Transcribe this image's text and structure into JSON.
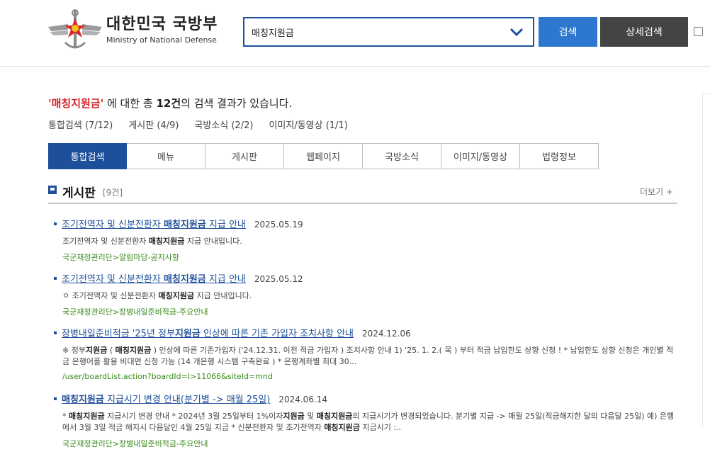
{
  "header": {
    "logo_ko": "대한민국 국방부",
    "logo_en": "Ministry of National Defense",
    "search_value": "매칭지원금",
    "search_button": "검색",
    "detail_button": "상세검색"
  },
  "summary": {
    "query_quoted": "'매칭지원금'",
    "text_before_count": " 에 대한 총 ",
    "count": "12건",
    "text_after_count": "의 검색 결과가 있습니다."
  },
  "category_counts": [
    "통합검색 (7/12)",
    "게시판 (4/9)",
    "국방소식 (2/2)",
    "이미지/동영상 (1/1)"
  ],
  "tabs": [
    {
      "label": "통합검색",
      "active": true
    },
    {
      "label": "메뉴",
      "active": false
    },
    {
      "label": "게시판",
      "active": false
    },
    {
      "label": "웹페이지",
      "active": false
    },
    {
      "label": "국방소식",
      "active": false
    },
    {
      "label": "이미지/동영상",
      "active": false
    },
    {
      "label": "법령정보",
      "active": false
    }
  ],
  "section": {
    "title": "게시판",
    "count": "[9건]",
    "more": "더보기 +"
  },
  "results": [
    {
      "title_pre": "조기전역자 및 신분전환자 ",
      "title_hl": "매칭지원금",
      "title_post": " 지급 안내",
      "date": "2025.05.19",
      "desc_pre": "조기전역자 및 신분전환자 ",
      "desc_hl": "매칭지원금",
      "desc_post": " 지급 안내입니다.",
      "path": "국군재정관리단>알림마당-공지사항"
    },
    {
      "title_pre": "조기전역자 및 신분전환자 ",
      "title_hl": "매칭지원금",
      "title_post": " 지급 안내",
      "date": "2025.05.12",
      "desc_pre": "ㅇ 조기전역자 및 신분전환자 ",
      "desc_hl": "매칭지원금",
      "desc_post": " 지급 안내입니다.",
      "path": "국군재정관리단>장병내일준비적금-주요안내"
    },
    {
      "title_pre": "장병내일준비적금 '25년 정부",
      "title_hl": "지원금",
      "title_post": " 인상에 따른 기존 가입자 조치사항 안내",
      "date": "2024.12.06",
      "desc_html": "※ 정부<b>지원금</b> ( <b>매칭지원금</b> ) 인상에 따른 기존가입자 ('24.12.31. 이전 적금 가입자 ) 조치사항 안내 1) '25. 1. 2.( 목 ) 부터 적금 납입한도 상향 신청 ! * 납입한도 상향 신청은 개인별 적금 은행어플 활용 비대면 신청 가능 (14 개은행 시스템 구축완료 ) * 은행계좌별 최대 30...",
      "path": "/user/boardList.action?boardId=I>11066&siteId=mnd"
    },
    {
      "title_pre": "",
      "title_hl": "매칭지원금",
      "title_post": " 지급시기 변경 안내(분기별 -> 매월 25일)",
      "date": "2024.06.14",
      "desc_html": "* <b>매칭지원금</b> 지급시기 변경 안내 * 2024년 3월 25일부터 1%이자<b>지원금</b> 및 <b>매칭지원금</b>의 지급시기가 변경되었습니다. 분기별 지급 -> 매월 25일(적금해지한 달의 다음달 25일) 예) 은행에서 3월 3일 적금 해지시 다음달인 4월 25일 지급 * 신분전환자 및 조기전역자 <b>매칭지원금</b> 지급시기 :..",
      "path": "국군재정관리단>장병내일준비적금-주요안내"
    }
  ],
  "colors": {
    "primary": "#1e4f9a",
    "search_btn": "#2e77d0",
    "detail_btn": "#444444",
    "query_red": "#d2262a",
    "path_green": "#3a8a1c"
  },
  "icons": [
    "mnd-emblem-logo",
    "chevron-down-icon",
    "section-square-icon"
  ]
}
